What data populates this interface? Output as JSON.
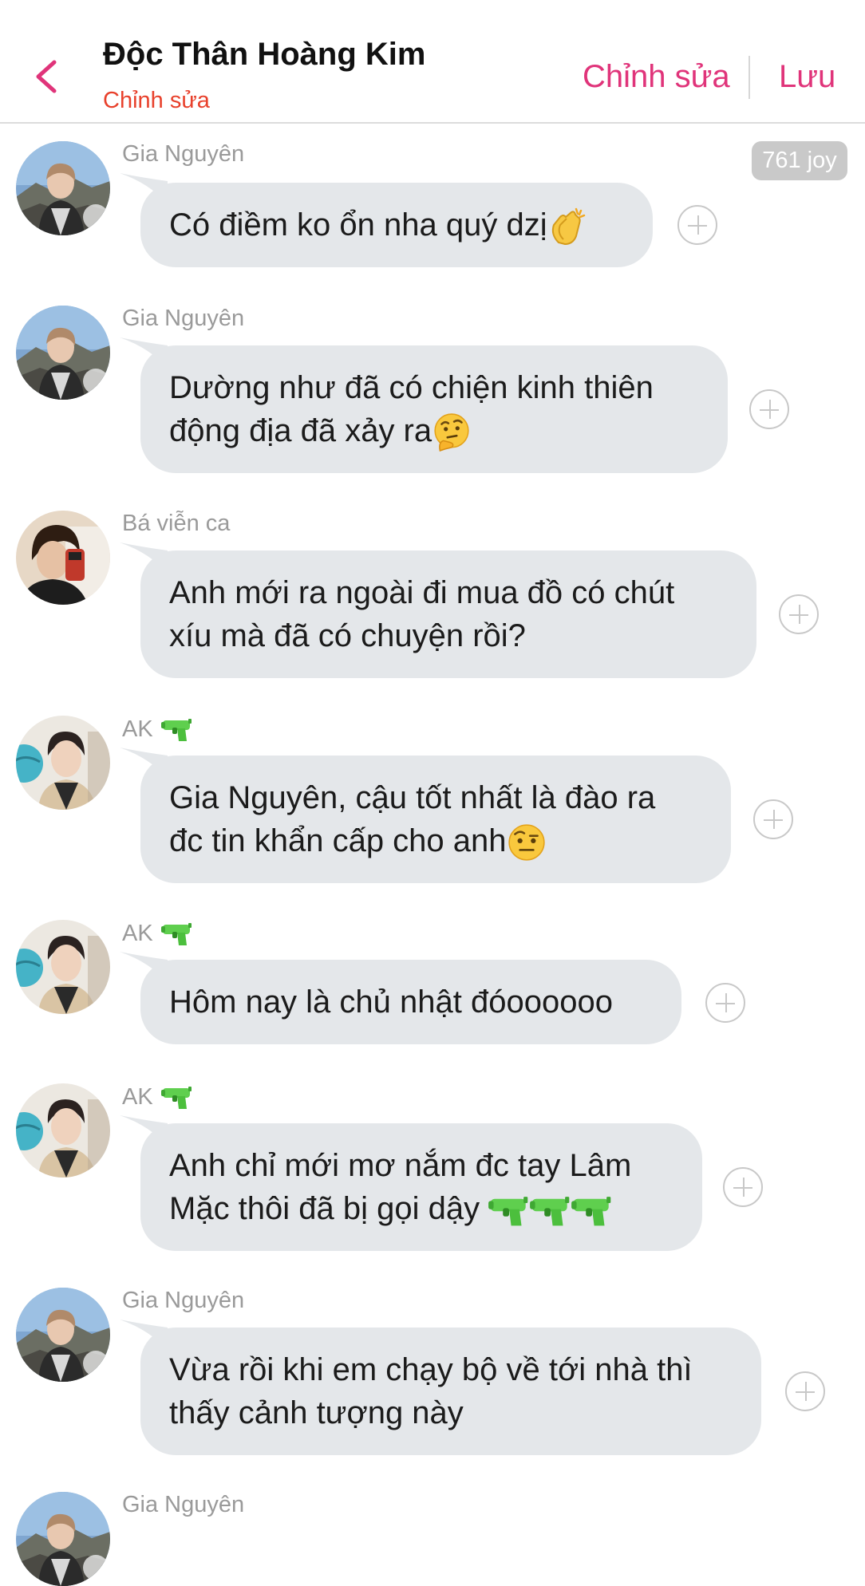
{
  "header": {
    "title": "Độc Thân Hoàng Kim",
    "subtitle": "Chỉnh sửa",
    "edit_label": "Chỉnh sửa",
    "save_label": "Lưu"
  },
  "joy_badge": "761 joy",
  "messages": [
    {
      "sender": "Gia Nguyên",
      "lines": [
        "Có điềm ko ổn nha quý dzị"
      ],
      "emoji_after": [
        "clapping-hands"
      ]
    },
    {
      "sender": "Gia Nguyên",
      "lines": [
        "Dường như đã có chiện kinh thiên",
        "động địa đã xảy ra"
      ],
      "emoji_after": [
        "thinking-face"
      ]
    },
    {
      "sender": "Bá viễn ca",
      "lines": [
        "Anh mới ra ngoài đi mua đồ có chút",
        "xíu mà đã có chuyện rồi?"
      ],
      "emoji_after": []
    },
    {
      "sender": "AK",
      "sender_emoji": "water-pistol",
      "lines": [
        "Gia Nguyên, cậu tốt nhất là đào ra",
        "đc tin khẩn cấp cho anh"
      ],
      "emoji_after": [
        "raised-eyebrow-face"
      ]
    },
    {
      "sender": "AK",
      "sender_emoji": "water-pistol",
      "lines": [
        "Hôm nay là chủ nhật đóoooooo"
      ],
      "emoji_after": []
    },
    {
      "sender": "AK",
      "sender_emoji": "water-pistol",
      "lines": [
        "Anh chỉ mới mơ nắm đc tay Lâm",
        "Mặc thôi đã bị gọi dậy "
      ],
      "emoji_after": [
        "water-pistol",
        "water-pistol",
        "water-pistol"
      ]
    },
    {
      "sender": "Gia Nguyên",
      "lines": [
        "Vừa rồi khi em chạy bộ về tới nhà thì",
        "thấy cảnh tượng này"
      ],
      "emoji_after": []
    },
    {
      "sender": "Gia Nguyên",
      "lines": [],
      "emoji_after": []
    }
  ],
  "colors": {
    "accent": "#e0347a",
    "subtitle": "#e8412c",
    "bubble": "#e4e7ea",
    "sender": "#9a9a9a"
  }
}
